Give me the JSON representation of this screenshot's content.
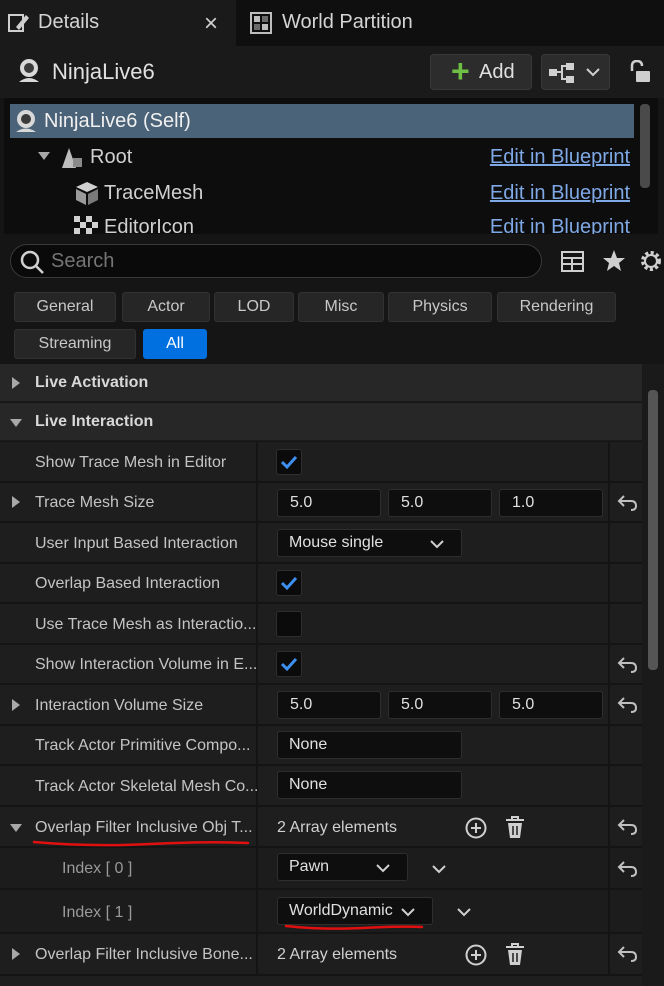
{
  "tabs": [
    {
      "label": "Details",
      "icon": "pencil-icon",
      "close": "×"
    },
    {
      "label": "World Partition",
      "icon": "grid-icon"
    }
  ],
  "actor": {
    "name": "NinjaLive6",
    "icon": "webcam-icon"
  },
  "toolbar": {
    "add_label": "Add",
    "add_symbol": "+"
  },
  "components": [
    {
      "label": "NinjaLive6 (Self)",
      "selected": true,
      "icon": "webcam-icon",
      "edit": ""
    },
    {
      "label": "Root",
      "icon": "scene-root-icon",
      "edit": "Edit in Blueprint"
    },
    {
      "label": "TraceMesh",
      "icon": "cube-icon",
      "edit": "Edit in Blueprint"
    },
    {
      "label": "EditorIcon",
      "icon": "checker-icon",
      "edit": "Edit in Blueprint"
    }
  ],
  "search": {
    "placeholder": "Search"
  },
  "categories": [
    "General",
    "Actor",
    "LOD",
    "Misc",
    "Physics",
    "Rendering",
    "Streaming",
    "All"
  ],
  "active_category": "All",
  "sections": {
    "live_activation": "Live Activation",
    "live_interaction": "Live Interaction"
  },
  "props": {
    "show_trace_mesh": {
      "label": "Show Trace Mesh in Editor",
      "checked": true
    },
    "trace_mesh_size": {
      "label": "Trace Mesh Size",
      "x": "5.0",
      "y": "5.0",
      "z": "1.0"
    },
    "user_input": {
      "label": "User Input Based Interaction",
      "value": "Mouse single"
    },
    "overlap_based": {
      "label": "Overlap Based Interaction",
      "checked": true
    },
    "use_trace_mesh": {
      "label": "Use Trace Mesh as Interactio...",
      "checked": false
    },
    "show_interaction_volume": {
      "label": "Show Interaction Volume in E...",
      "checked": true
    },
    "interaction_volume_size": {
      "label": "Interaction Volume Size",
      "x": "5.0",
      "y": "5.0",
      "z": "5.0"
    },
    "track_primitive": {
      "label": "Track Actor Primitive Compo...",
      "value": "None"
    },
    "track_skeletal": {
      "label": "Track Actor Skeletal Mesh Co...",
      "value": "None"
    },
    "overlap_filter_obj": {
      "label": "Overlap Filter Inclusive Obj T...",
      "value": "2 Array elements"
    },
    "index0": {
      "label": "Index [ 0 ]",
      "value": "Pawn"
    },
    "index1": {
      "label": "Index [ 1 ]",
      "value": "WorldDynamic"
    },
    "overlap_filter_bone": {
      "label": "Overlap Filter Inclusive Bone...",
      "value": "2 Array elements"
    }
  },
  "colors": {
    "accent": "#0070e0",
    "link": "#7fa8e6",
    "annotation": "#e01010",
    "selected_row": "#4b6378"
  }
}
